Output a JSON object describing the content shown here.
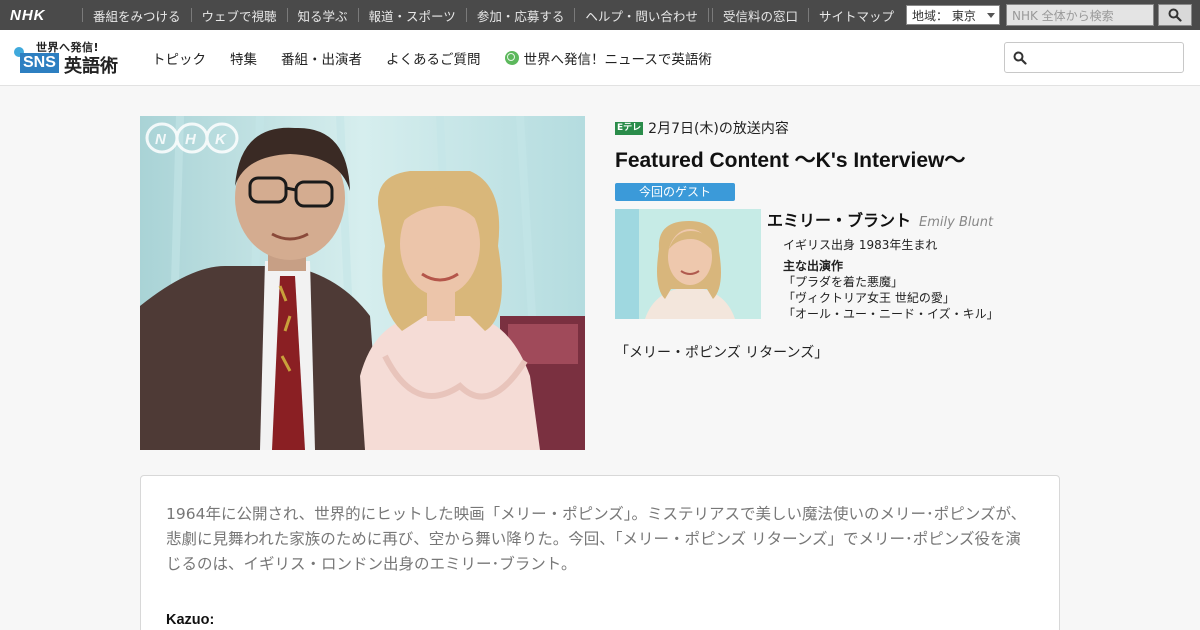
{
  "topbar": {
    "logo": "NHK",
    "nav": [
      "番組をみつける",
      "ウェブで視聴",
      "知る学ぶ",
      "報道・スポーツ",
      "参加・応募する",
      "ヘルプ・問い合わせ"
    ],
    "right": [
      "受信料の窓口",
      "サイトマップ"
    ],
    "region_label": "地域： 東京",
    "search_placeholder": "NHK 全体から検索"
  },
  "site": {
    "logo_small": "世界へ発信!",
    "logo_sns": "SNS",
    "logo_main": "英語術",
    "nav": [
      "トピック",
      "特集",
      "番組・出演者",
      "よくあるご質問",
      "世界へ発信！ニュースで英語術"
    ]
  },
  "episode": {
    "channel": "Eテレ",
    "air_date": "2月7日(木)の放送内容",
    "title": "Featured Content 〜K's Interview〜",
    "guest_badge": "今回のゲスト",
    "guest": {
      "name_ja": "エミリー・ブラント",
      "name_en": "Emily Blunt",
      "profile": "イギリス出身 1983年生まれ",
      "works_heading": "主な出演作",
      "works": [
        "「プラダを着た悪魔」",
        "「ヴィクトリア女王 世紀の愛」",
        "「オール・ユー・ニード・イズ・キル」"
      ]
    },
    "featured_film": "「メリー・ポピンズ リターンズ」",
    "photo_watermark": "NHK"
  },
  "article": {
    "intro": "1964年に公開され、世界的にヒットした映画「メリー・ポピンズ」。ミステリアスで美しい魔法使いのメリー･ポピンズが、悲劇に見舞われた家族のために再び、空から舞い降りた。今回、「メリー・ポピンズ リターンズ」でメリー･ポピンズ役を演じるのは、イギリス・ロンドン出身のエミリー･ブラント。",
    "speaker": "Kazuo:"
  },
  "colors": {
    "topbar": "#4a4a4a",
    "accent": "#3b9ad9",
    "etele": "#2a8c4a"
  }
}
